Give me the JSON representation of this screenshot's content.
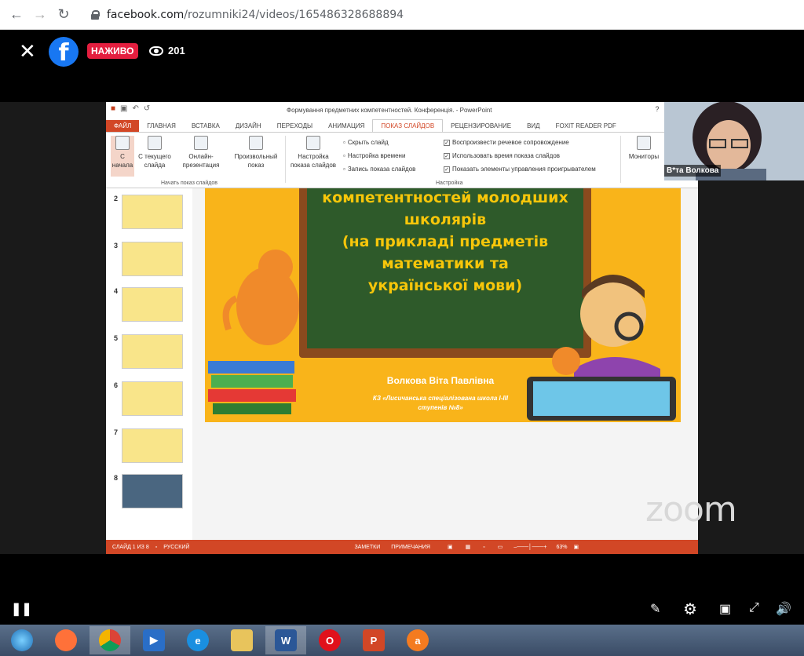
{
  "browser": {
    "url_domain": "facebook.com",
    "url_path": "/rozumniki24/videos/165486328688894"
  },
  "fb": {
    "live_label": "НАЖИВО",
    "viewer_count": "201"
  },
  "ppt": {
    "doc_title": "Формування предметних компетентностей. Конференція. - PowerPoint",
    "tabs": [
      "ФАЙЛ",
      "ГЛАВНАЯ",
      "ВСТАВКА",
      "ДИЗАЙН",
      "ПЕРЕХОДЫ",
      "АНИМАЦИЯ",
      "ПОКАЗ СЛАЙДОВ",
      "РЕЦЕНЗИРОВАНИЕ",
      "ВИД",
      "FOXIT READER PDF"
    ],
    "ribbon": {
      "from_start": "С начала",
      "from_current": "С текущего слайда",
      "online": "Онлайн-презентация",
      "custom": "Произвольный показ",
      "group_start": "Начать показ слайдов",
      "setup": "Настройка показа слайдов",
      "hide_slide": "Скрыть слайд",
      "rehearse": "Настройка времени",
      "record": "Запись показа слайдов",
      "play_narration": "Воспроизвести речевое сопровождение",
      "use_timings": "Использовать время показа слайдов",
      "show_controls": "Показать элементы управления проигрывателем",
      "group_setup": "Настройка",
      "monitors": "Мониторы"
    },
    "thumb_numbers": [
      "2",
      "3",
      "4",
      "5",
      "6",
      "7",
      "8"
    ],
    "slide": {
      "line1": "компетентностей молодших",
      "line2": "школярів",
      "line3": "(на прикладі предметів",
      "line4": "математики та",
      "line5": "української мови)",
      "author": "Волкова Віта Павлівна",
      "school_line1": "КЗ «Лисичанська спеціалізована школа І-ІІІ",
      "school_line2": "ступенів №8»"
    },
    "status": {
      "slide_of": "СЛАЙД 1 ИЗ 8",
      "language": "РУССКИЙ",
      "notes": "ЗАМЕТКИ",
      "comments": "ПРИМЕЧАНИЯ",
      "zoom": "63%"
    }
  },
  "presenter": {
    "name": "В*та Волкова"
  },
  "watermark": "zoom"
}
